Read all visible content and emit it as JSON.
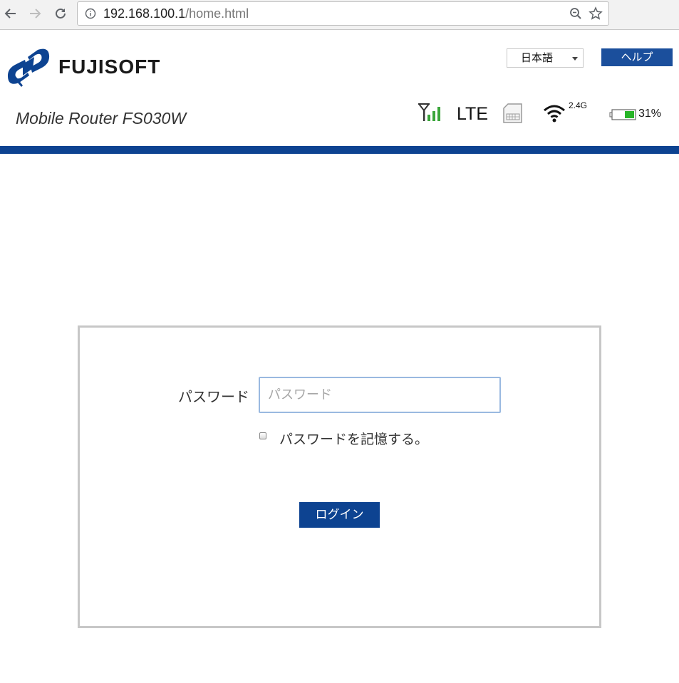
{
  "browser": {
    "url_host": "192.168.100.1",
    "url_path": "/home.html",
    "icons": [
      "back-arrow-icon",
      "forward-arrow-icon",
      "reload-icon",
      "info-icon",
      "zoom-out-icon",
      "bookmark-star-icon"
    ]
  },
  "header": {
    "brand": "FUJISOFT",
    "language": "日本語",
    "help_label": "ヘルプ",
    "model": "Mobile Router FS030W"
  },
  "status": {
    "network": "LTE",
    "wifi_band": "2.4G",
    "battery": "31%",
    "icons": [
      "signal-strength-icon",
      "sim-card-icon",
      "wifi-icon",
      "battery-icon"
    ]
  },
  "login": {
    "password_label": "パスワード",
    "password_placeholder": "パスワード",
    "password_value": "",
    "remember_label": "パスワードを記憶する。",
    "remember_checked": false,
    "login_label": "ログイン"
  },
  "colors": {
    "brand_blue": "#0d4391",
    "help_blue": "#1b4f9c",
    "signal_green": "#3aa53a",
    "battery_green": "#27b427"
  }
}
